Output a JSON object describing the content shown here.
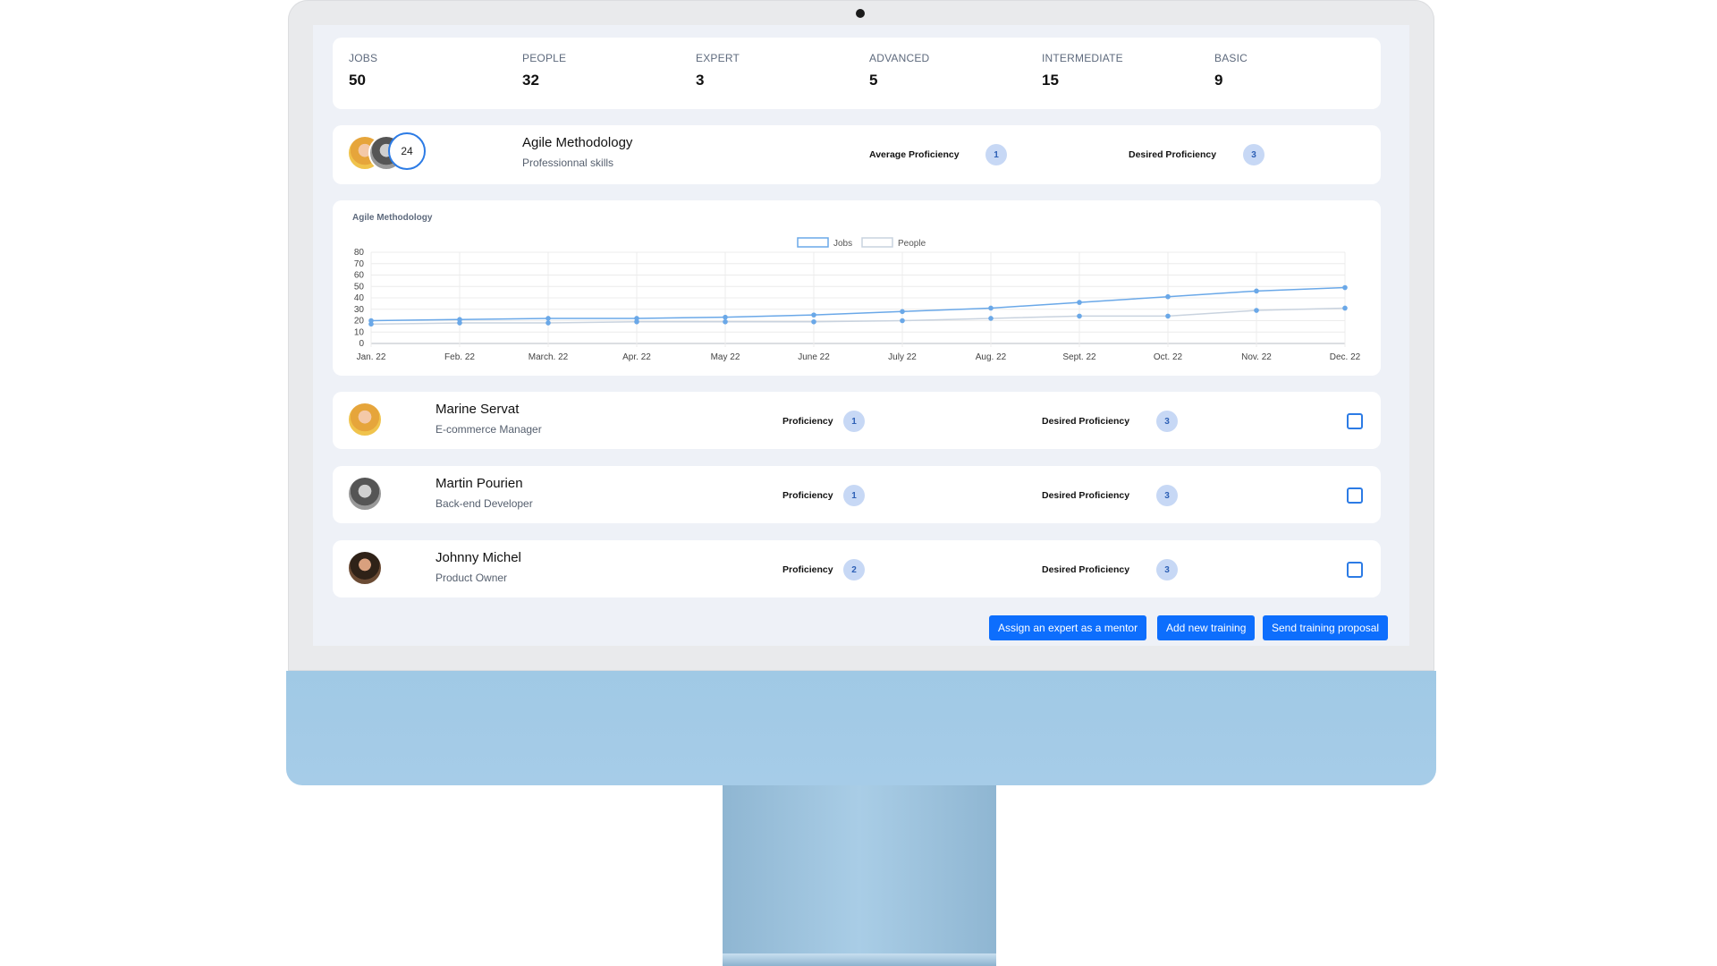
{
  "stats": [
    {
      "label": "JOBS",
      "value": "50"
    },
    {
      "label": "PEOPLE",
      "value": "32"
    },
    {
      "label": "EXPERT",
      "value": "3"
    },
    {
      "label": "ADVANCED",
      "value": "5"
    },
    {
      "label": "INTERMEDIATE",
      "value": "15"
    },
    {
      "label": "BASIC",
      "value": "9"
    }
  ],
  "skill": {
    "title": "Agile Methodology",
    "category": "Professionnal skills",
    "people_count": "24",
    "avg_label": "Average Proficiency",
    "avg_value": "1",
    "desired_label": "Desired Proficiency",
    "desired_value": "3"
  },
  "chart_data": {
    "type": "line",
    "title": "Agile Methodology",
    "categories": [
      "Jan. 22",
      "Feb. 22",
      "March. 22",
      "Apr. 22",
      "May 22",
      "June 22",
      "July 22",
      "Aug. 22",
      "Sept. 22",
      "Oct. 22",
      "Nov. 22",
      "Dec. 22"
    ],
    "series": [
      {
        "name": "Jobs",
        "values": [
          20,
          21,
          22,
          22,
          23,
          25,
          28,
          31,
          36,
          41,
          46,
          49
        ]
      },
      {
        "name": "People",
        "values": [
          17,
          18,
          18,
          19,
          19,
          19,
          20,
          22,
          24,
          24,
          29,
          31
        ]
      }
    ],
    "yticks": [
      "0",
      "10",
      "20",
      "30",
      "40",
      "50",
      "60",
      "70",
      "80"
    ],
    "ylim": [
      0,
      80
    ],
    "grid": true,
    "legend": "top",
    "colors": {
      "Jobs": "#6aa8e8",
      "People": "#c9d3df"
    }
  },
  "people": [
    {
      "name": "Marine Servat",
      "role": "E-commerce Manager",
      "proficiency_label": "Proficiency",
      "proficiency": "1",
      "desired_label": "Desired Proficiency",
      "desired": "3"
    },
    {
      "name": "Martin Pourien",
      "role": "Back-end Developer",
      "proficiency_label": "Proficiency",
      "proficiency": "1",
      "desired_label": "Desired Proficiency",
      "desired": "3"
    },
    {
      "name": "Johnny Michel",
      "role": "Product Owner",
      "proficiency_label": "Proficiency",
      "proficiency": "2",
      "desired_label": "Desired Proficiency",
      "desired": "3"
    }
  ],
  "actions": {
    "mentor": "Assign an expert as a mentor",
    "training": "Add new training",
    "proposal": "Send training proposal"
  },
  "colors": {
    "accent": "#0d6efd",
    "badge_bg": "#c7d8f5",
    "chin": "#a3cae6"
  }
}
